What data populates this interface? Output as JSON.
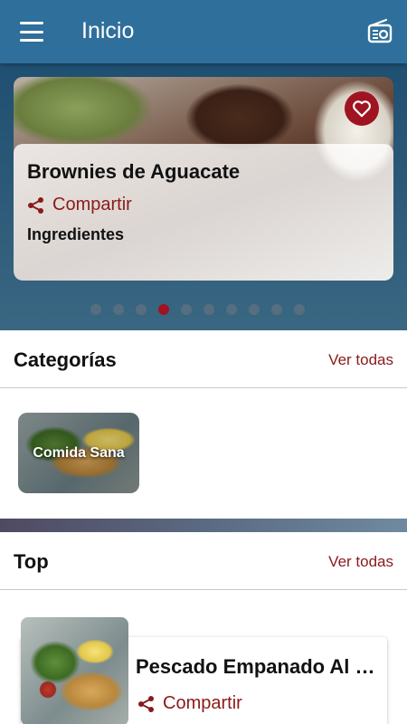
{
  "app_bar": {
    "title": "Inicio",
    "menu_icon": "hamburger-menu-icon",
    "radio_icon": "radio-icon",
    "background": "#2f6f9b"
  },
  "hero": {
    "title": "Brownies de Aguacate",
    "share_label": "Compartir",
    "ingredients_label": "Ingredientes",
    "favorite_icon": "heart-icon",
    "carousel": {
      "total": 10,
      "active_index": 3
    }
  },
  "categories": {
    "title": "Categorías",
    "see_all": "Ver todas",
    "items": [
      {
        "label": "Comida Sana"
      }
    ]
  },
  "top": {
    "title": "Top",
    "see_all": "Ver todas",
    "items": [
      {
        "title": "Pescado Empanado Al Horno con Ensalada",
        "share_label": "Compartir"
      }
    ]
  },
  "colors": {
    "accent": "#8b1a1a",
    "favorite_bg": "#a01320",
    "dot_inactive": "#566e80"
  }
}
